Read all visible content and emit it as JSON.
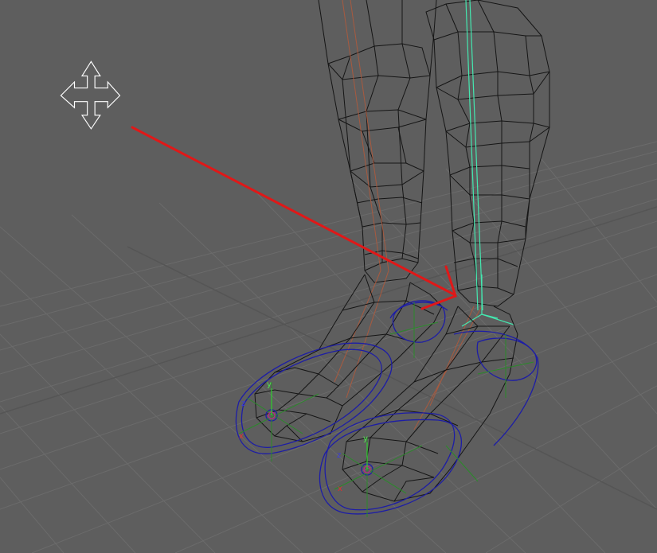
{
  "viewport": {
    "background": "#5e5e5e",
    "grid_color": "#6a6a6a",
    "wireframe_color": "#111111",
    "skeleton_color": "#b05a3c",
    "selected_joint_color": "#44e8b0",
    "control_curve_color": "#1a1aa0",
    "manipulator_color": "#2a8a2a",
    "annotation_arrow_color": "#e01818"
  },
  "cursor": {
    "icon": "move-cursor-icon"
  },
  "gizmos": {
    "left_foot": {
      "y_label": "y",
      "z_label": "z",
      "x_label": "x"
    },
    "right_foot": {
      "y_label": "y",
      "z_label": "z",
      "x_label": "x"
    }
  },
  "annotation": {
    "icon": "annotation-arrow-icon"
  }
}
